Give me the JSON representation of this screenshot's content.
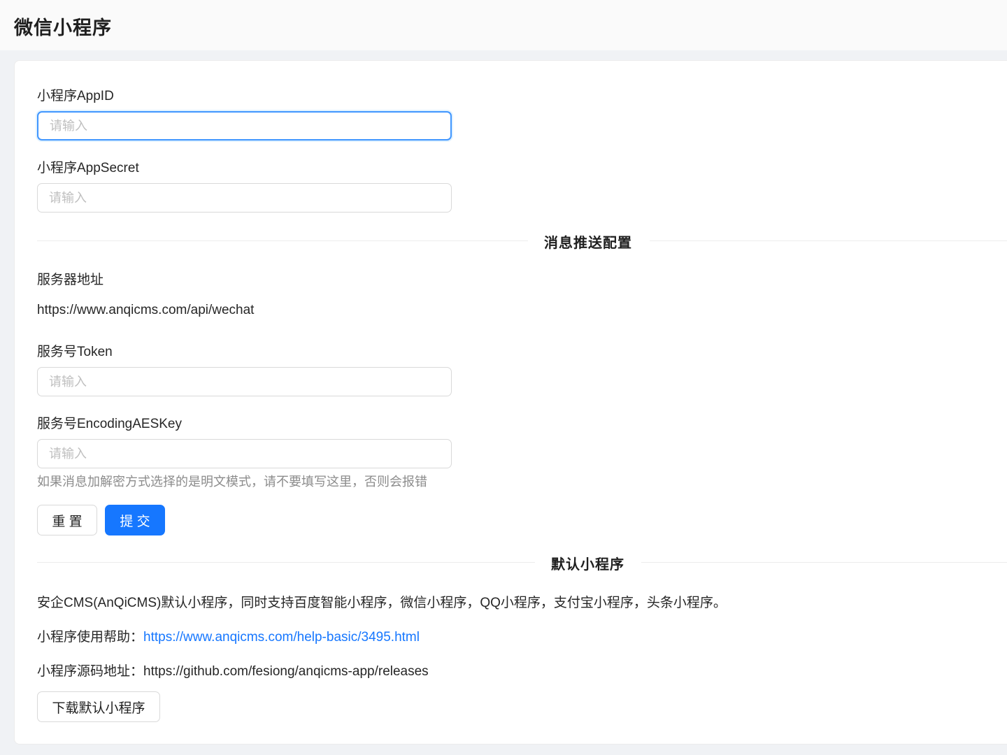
{
  "header": {
    "title": "微信小程序"
  },
  "form": {
    "appid_label": "小程序AppID",
    "appid_placeholder": "请输入",
    "appsecret_label": "小程序AppSecret",
    "appsecret_placeholder": "请输入",
    "push_divider": "消息推送配置",
    "server_label": "服务器地址",
    "server_value": "https://www.anqicms.com/api/wechat",
    "token_label": "服务号Token",
    "token_placeholder": "请输入",
    "aeskey_label": "服务号EncodingAESKey",
    "aeskey_placeholder": "请输入",
    "aeskey_help": "如果消息加解密方式选择的是明文模式，请不要填写这里，否则会报错",
    "reset_label": "重 置",
    "submit_label": "提 交"
  },
  "default_app": {
    "divider": "默认小程序",
    "description": "安企CMS(AnQiCMS)默认小程序，同时支持百度智能小程序，微信小程序，QQ小程序，支付宝小程序，头条小程序。",
    "help_prefix": "小程序使用帮助：",
    "help_link": "https://www.anqicms.com/help-basic/3495.html",
    "source_prefix": "小程序源码地址：",
    "source_url": "https://github.com/fesiong/anqicms-app/releases",
    "download_label": "下载默认小程序"
  },
  "colors": {
    "primary": "#1677ff",
    "focus_border": "#4096ff",
    "background": "#f0f2f5"
  }
}
